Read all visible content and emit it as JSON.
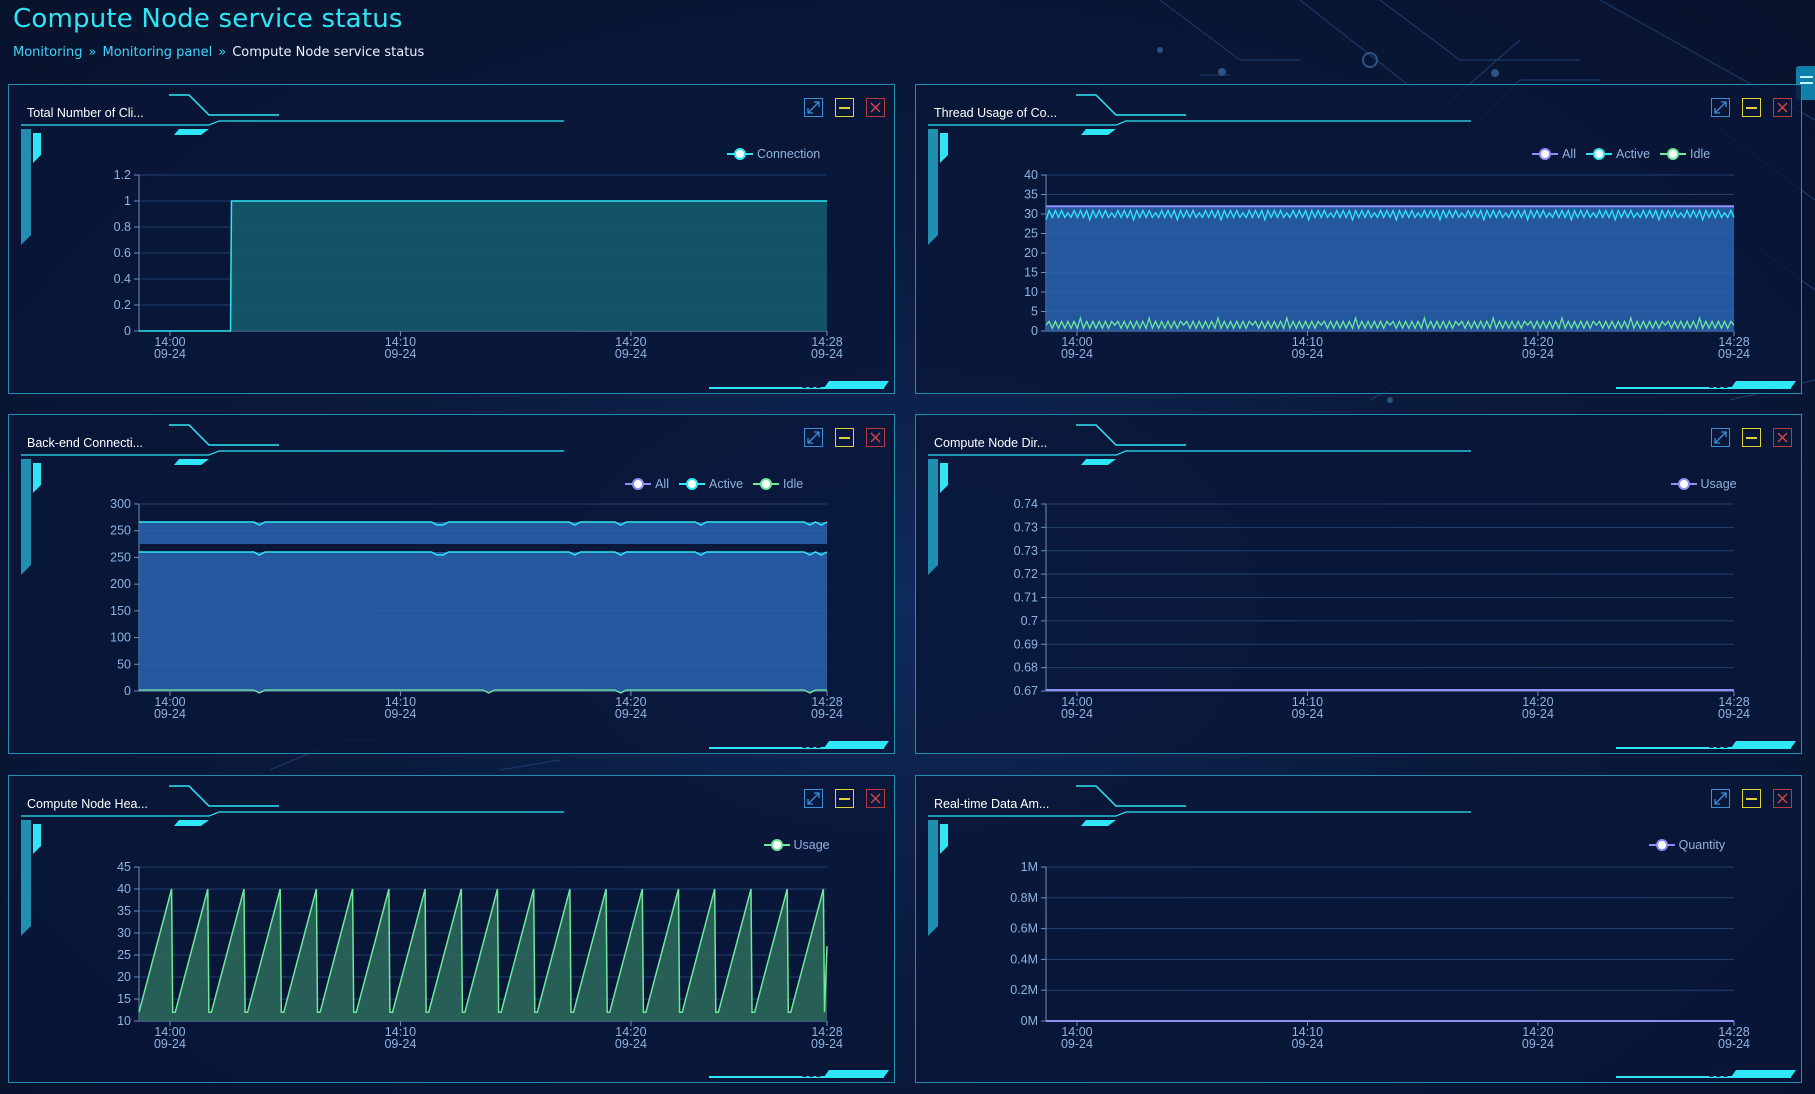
{
  "header": {
    "title": "Compute Node service status",
    "breadcrumb": [
      "Monitoring",
      "Monitoring panel",
      "Compute Node service status"
    ],
    "separator": "»"
  },
  "x_ticks": [
    {
      "time": "14:00",
      "date": "09-24"
    },
    {
      "time": "14:10",
      "date": "09-24"
    },
    {
      "time": "14:20",
      "date": "09-24"
    },
    {
      "time": "14:28",
      "date": "09-24"
    }
  ],
  "colors": {
    "cyan": "#2ee6f5",
    "green": "#6ee89a",
    "purple": "#8f8ff5",
    "area_teal": "#155a6e",
    "area_blue": "#2a63b1",
    "area_green": "#2d6b5c"
  },
  "panels": [
    {
      "title": "Total Number of Cli...",
      "chart_data": {
        "type": "area",
        "series": [
          {
            "name": "Connection",
            "color": "#2ee6f5"
          }
        ],
        "y_ticks": [
          "1.2",
          "1",
          "0.8",
          "0.6",
          "0.4",
          "0.2",
          "0"
        ],
        "ylim": [
          0,
          1.2
        ],
        "description_values": {
          "start": 0,
          "step_time": "14:04",
          "after": 1
        }
      }
    },
    {
      "title": "Thread Usage of Co...",
      "chart_data": {
        "type": "area",
        "series": [
          {
            "name": "All",
            "color": "#8f8ff5",
            "approx": 32
          },
          {
            "name": "Active",
            "color": "#2ee6f5",
            "approx": 30
          },
          {
            "name": "Idle",
            "color": "#6ee89a",
            "approx": 1.5
          }
        ],
        "y_ticks": [
          "40",
          "35",
          "30",
          "25",
          "20",
          "15",
          "10",
          "5",
          "0"
        ],
        "ylim": [
          0,
          40
        ]
      }
    },
    {
      "title": "Back-end Connecti...",
      "chart_data": {
        "type": "area",
        "series": [
          {
            "name": "All",
            "color": "#8f8ff5",
            "approx": 265
          },
          {
            "name": "Active",
            "color": "#2ee6f5",
            "approx": 260
          },
          {
            "name": "Idle",
            "color": "#6ee89a",
            "approx": 1
          }
        ],
        "y_ticks": [
          "300",
          "250",
          "250",
          "200",
          "150",
          "100",
          "50",
          "0"
        ],
        "ylim": [
          0,
          300
        ]
      }
    },
    {
      "title": "Compute Node Dir...",
      "chart_data": {
        "type": "line",
        "series": [
          {
            "name": "Usage",
            "color": "#8f8ff5",
            "approx": 0.67
          }
        ],
        "y_ticks": [
          "0.74",
          "0.73",
          "0.73",
          "0.72",
          "0.71",
          "0.7",
          "0.69",
          "0.68",
          "0.67"
        ],
        "ylim": [
          0.67,
          0.74
        ]
      }
    },
    {
      "title": "Compute Node Hea...",
      "chart_data": {
        "type": "area",
        "series": [
          {
            "name": "Usage",
            "color": "#6ee89a",
            "min": 12,
            "max": 40
          }
        ],
        "y_ticks": [
          "45",
          "40",
          "35",
          "30",
          "25",
          "20",
          "15",
          "10"
        ],
        "ylim": [
          10,
          45
        ]
      }
    },
    {
      "title": "Real-time Data Am...",
      "chart_data": {
        "type": "line",
        "series": [
          {
            "name": "Quantity",
            "color": "#8f8ff5",
            "approx": 0
          }
        ],
        "y_ticks": [
          "1M",
          "0.8M",
          "0.6M",
          "0.4M",
          "0.2M",
          "0M"
        ],
        "ylim": [
          0,
          1000000
        ]
      }
    }
  ]
}
